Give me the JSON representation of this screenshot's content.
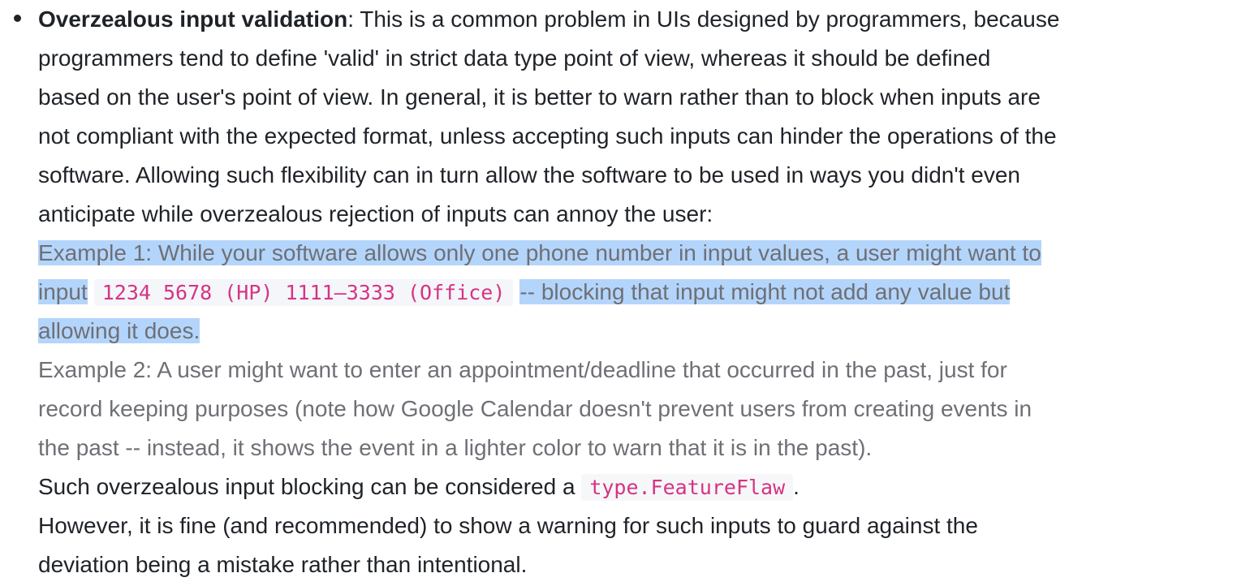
{
  "bullet": {
    "title": "Overzealous input validation",
    "lines": [
      ": This is a common problem in UIs designed by programmers, because",
      "programmers tend to define 'valid' in strict data type point of view, whereas it should be defined",
      "based on the user's point of view. In general, it is better to warn rather than to block when inputs are",
      "not compliant with the expected format, unless accepting such inputs can hinder the operations of the",
      "software. Allowing such flexibility can in turn allow the software to be used in ways you didn't even",
      "anticipate while overzealous rejection of inputs can annoy the user:"
    ],
    "example1": {
      "line1": "Example 1: While your software allows only one phone number in input values, a user might want to",
      "line2_before": "input",
      "code": "1234 5678 (HP) 1111–3333 (Office)",
      "line2_after": "-- blocking that input might not add any value but",
      "line3": "allowing it does."
    },
    "example2": [
      "Example 2: A user might want to enter an appointment/deadline that occurred in the past, just for",
      "record keeping purposes (note how Google Calendar doesn't prevent users from creating events in",
      "the past -- instead, it shows the event in a lighter color to warn that it is in the past)."
    ],
    "conclusion": {
      "before": "Such overzealous input blocking can be considered a",
      "code": "type.FeatureFlaw",
      "after": "."
    },
    "note": [
      "However, it is fine (and recommended) to show a warning for such inputs to guard against the",
      "deviation being a mistake rather than intentional."
    ]
  }
}
